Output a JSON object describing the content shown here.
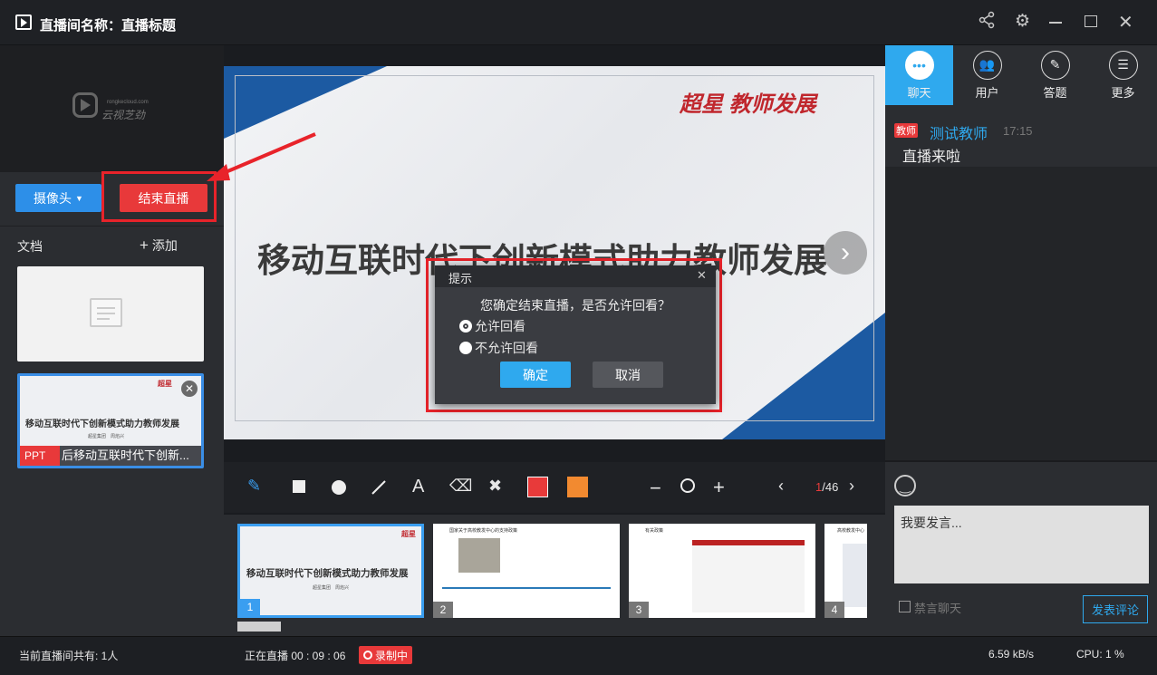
{
  "titlebar": {
    "title": "直播间名称：直播标题"
  },
  "logo_text": {
    "url": "rongkecloud.com",
    "name": "云视芝劲"
  },
  "left": {
    "camera_label": "摄像头",
    "end_live_label": "结束直播",
    "docs_label": "文档",
    "add_label": "添加",
    "doc2": {
      "title": "移动互联时代下创新模式助力教师发展",
      "sub": "超星集团　周焰兴",
      "tag": "PPT",
      "name": "后移动互联时代下创新..."
    }
  },
  "slide": {
    "title": "移动互联时代下创新模式助力教师发展",
    "brand": "超星 教师发展",
    "arrow": "›"
  },
  "dialog": {
    "title": "提示",
    "message": "您确定结束直播，是否允许回看？",
    "option1": "允许回看",
    "option2": "不允许回看",
    "confirm": "确定",
    "cancel": "取消"
  },
  "toolbar": {
    "page_current": "1",
    "page_total": "/46",
    "colors": [
      "#e83a3a",
      "#f28a30"
    ]
  },
  "thumbs": [
    {
      "num": "1",
      "title": "移动互联时代下创新模式助力教师发展",
      "sub": "超星集团　周焰兴"
    },
    {
      "num": "2",
      "header": "国家关于高校教发中心的支持政策"
    },
    {
      "num": "3",
      "header": "有关政策"
    },
    {
      "num": "4",
      "header": "高校教发中心"
    }
  ],
  "right": {
    "tabs": [
      {
        "label": "聊天",
        "icon": "chat-icon"
      },
      {
        "label": "用户",
        "icon": "users-icon"
      },
      {
        "label": "答题",
        "icon": "pen-icon"
      },
      {
        "label": "更多",
        "icon": "more-icon"
      }
    ],
    "message": {
      "badge": "教师",
      "name": "测试教师",
      "time": "17:15",
      "text": "直播来啦"
    },
    "input_placeholder": "我要发言...",
    "mute_label": "禁言聊天",
    "send_label": "发表评论"
  },
  "status": {
    "viewers": "当前直播间共有: 1人",
    "live_time": "正在直播 00 : 09 : 06",
    "recording": "录制中",
    "speed": "6.59 kB/s",
    "cpu": "CPU:  1 %"
  }
}
